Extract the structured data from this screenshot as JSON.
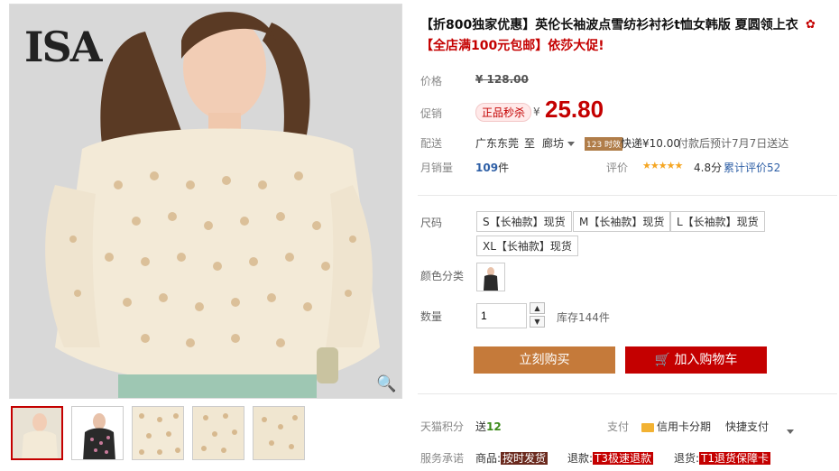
{
  "gallery": {
    "logo_text": "ISA",
    "zoom_icon": "magnifier-icon",
    "thumbnails": [
      "thumb-1",
      "thumb-2",
      "thumb-3",
      "thumb-4",
      "thumb-5"
    ]
  },
  "product": {
    "title": "【折800独家优惠】英伦长袖波点雪纺衫衬衫t恤女韩版 夏圆领上衣",
    "promo": "【全店满100元包邮】依莎大促!",
    "price_label": "价格",
    "original_price": "¥ 128.00",
    "promo_label": "促销",
    "flash_badge": "正品秒杀",
    "currency": "¥",
    "sale_price": "25.80",
    "shipping_label": "配送",
    "ship_from": "广东东莞",
    "ship_to_word": "至",
    "ship_to": "廊坊",
    "ship_badge": "123 时效",
    "ship_fee": "快递¥10.00",
    "ship_eta": "付款后预计7月7日送达",
    "monthly_sales_label": "月销量",
    "monthly_sales_value": "109",
    "monthly_sales_unit": "件",
    "rating_label": "评价",
    "stars": "★★★★★",
    "rating_score": "4.8分",
    "review_count": "累计评价52",
    "size_label": "尺码",
    "sizes": [
      "S【长袖款】现货",
      "M【长袖款】现货",
      "L【长袖款】现货",
      "XL【长袖款】现货"
    ],
    "color_label": "颜色分类",
    "quantity_label": "数量",
    "quantity_value": "1",
    "stock_text": "库存144件",
    "buy_now": "立刻购买",
    "add_to_cart": "加入购物车",
    "points_label": "天猫积分",
    "points_prefix": "送",
    "points_value": "12",
    "pay_label": "支付",
    "pay_credit": "信用卡分期",
    "pay_quick": "快捷支付",
    "service_label": "服务承诺",
    "service_goods": "商品:",
    "service_goods_tag": "按时发货",
    "service_refund": "退款:",
    "service_refund_tag": "T3极速退款",
    "service_return": "退货:",
    "service_return_tag": "T1退货保障卡"
  },
  "colors": {
    "accent_red": "#c40000",
    "buy_button": "#c57a3a",
    "link_blue": "#2e5fa6"
  }
}
